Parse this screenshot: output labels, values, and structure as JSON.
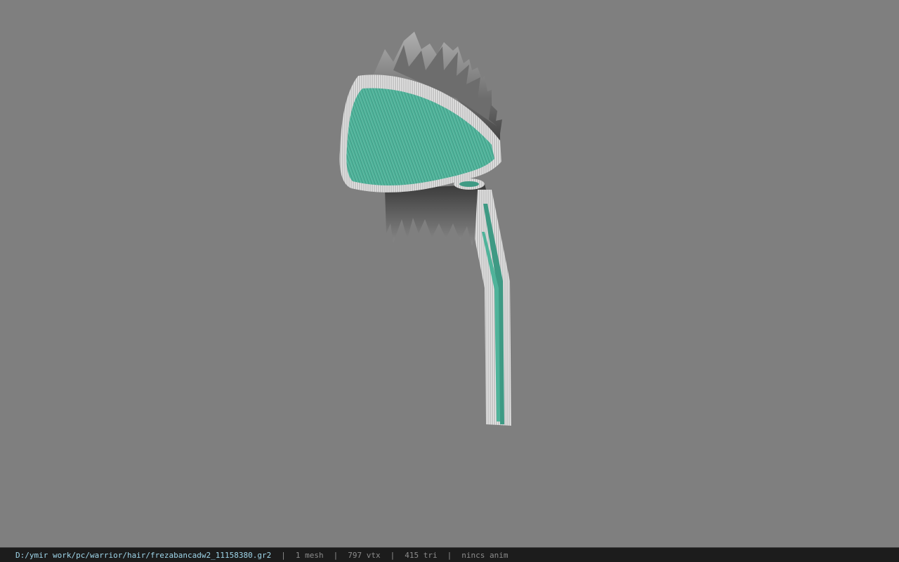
{
  "viewport": {
    "background": "#7f7f7f",
    "model_icon": "hair-model-icon",
    "colors": {
      "hair": "#5a5a5a",
      "band_teal": "#4fb39a",
      "band_trim": "#c8c8c8"
    }
  },
  "statusbar": {
    "path": "D:/ymir work/pc/warrior/hair/frezabancadw2_11158380.gr2",
    "separator": "|",
    "mesh": "1 mesh",
    "vtx": "797 vtx",
    "tri": "415 tri",
    "anim": "nincs anim",
    "colors": {
      "path": "#9fd6ea",
      "text": "#8c8c8c",
      "background": "#1c1c1c"
    }
  }
}
